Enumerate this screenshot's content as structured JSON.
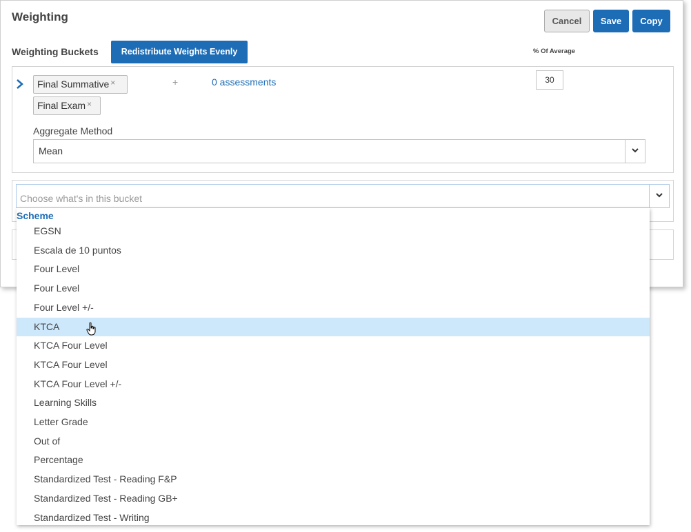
{
  "header": {
    "title": "Weighting",
    "cancel_label": "Cancel",
    "save_label": "Save",
    "copy_label": "Copy"
  },
  "buckets_section": {
    "label": "Weighting Buckets",
    "redistribute_label": "Redistribute Weights Evenly",
    "percent_header": "% Of Average"
  },
  "bucket": {
    "tags": [
      "Final Summative",
      "Final Exam"
    ],
    "tag_remove_glyph": "×",
    "plus_glyph": "+",
    "assessments_link": "0 assessments",
    "percent_value": "30",
    "aggregate_label": "Aggregate Method",
    "aggregate_value": "Mean"
  },
  "bucket_chooser": {
    "placeholder": "Choose what's in this bucket"
  },
  "dropdown": {
    "group_label": "Scheme",
    "highlighted_index": 5,
    "options": [
      "EGSN",
      "Escala de 10 puntos",
      "Four Level",
      "Four Level",
      "Four Level +/-",
      "KTCA",
      "KTCA Four Level",
      "KTCA Four Level",
      "KTCA Four Level +/-",
      "Learning Skills",
      "Letter Grade",
      "Out of",
      "Percentage",
      "Standardized Test - Reading F&P",
      "Standardized Test - Reading GB+",
      "Standardized Test - Writing"
    ]
  },
  "colors": {
    "accent": "#1c6cb6",
    "highlight": "#cde7fb"
  }
}
